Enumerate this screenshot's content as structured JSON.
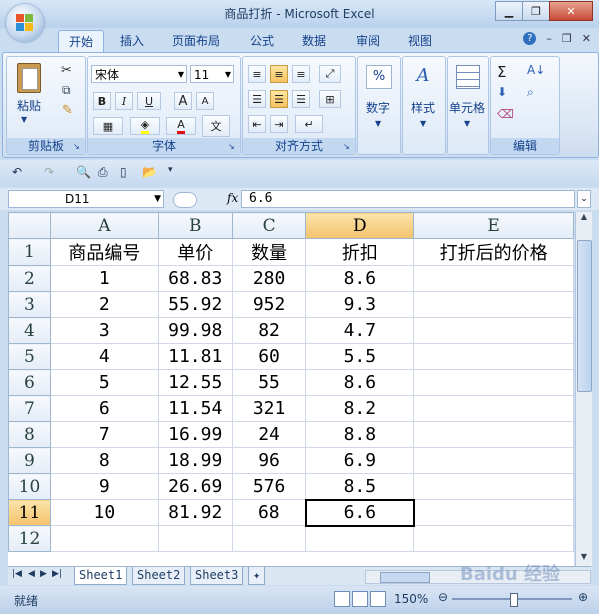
{
  "window": {
    "title": "商品打折 - Microsoft Excel"
  },
  "ribbon_tabs": [
    "开始",
    "插入",
    "页面布局",
    "公式",
    "数据",
    "审阅",
    "视图"
  ],
  "ribbon": {
    "clipboard": {
      "label": "剪贴板",
      "paste": "粘贴"
    },
    "font": {
      "label": "字体",
      "name": "宋体",
      "size": "11",
      "bold": "B",
      "italic": "I",
      "underline": "U",
      "grow": "A",
      "shrink": "A",
      "color": "A",
      "wen": "文"
    },
    "alignment": {
      "label": "对齐方式"
    },
    "number": {
      "label": "数字",
      "percent": "%"
    },
    "styles": {
      "label": "样式"
    },
    "cells": {
      "label": "单元格"
    },
    "editing": {
      "label": "编辑",
      "sum": "Σ"
    }
  },
  "formula_bar": {
    "name_box": "D11",
    "fx": "fx",
    "value": "6.6"
  },
  "sheet": {
    "columns": [
      "A",
      "B",
      "C",
      "D",
      "E"
    ],
    "rows": [
      {
        "num": "1",
        "cells": [
          "商品编号",
          "单价",
          "数量",
          "折扣",
          "打折后的价格"
        ]
      },
      {
        "num": "2",
        "cells": [
          "1",
          "68.83",
          "280",
          "8.6",
          ""
        ]
      },
      {
        "num": "3",
        "cells": [
          "2",
          "55.92",
          "952",
          "9.3",
          ""
        ]
      },
      {
        "num": "4",
        "cells": [
          "3",
          "99.98",
          "82",
          "4.7",
          ""
        ]
      },
      {
        "num": "5",
        "cells": [
          "4",
          "11.81",
          "60",
          "5.5",
          ""
        ]
      },
      {
        "num": "6",
        "cells": [
          "5",
          "12.55",
          "55",
          "8.6",
          ""
        ]
      },
      {
        "num": "7",
        "cells": [
          "6",
          "11.54",
          "321",
          "8.2",
          ""
        ]
      },
      {
        "num": "8",
        "cells": [
          "7",
          "16.99",
          "24",
          "8.8",
          ""
        ]
      },
      {
        "num": "9",
        "cells": [
          "8",
          "18.99",
          "96",
          "6.9",
          ""
        ]
      },
      {
        "num": "10",
        "cells": [
          "9",
          "26.69",
          "576",
          "8.5",
          ""
        ]
      },
      {
        "num": "11",
        "cells": [
          "10",
          "81.92",
          "68",
          "6.6",
          ""
        ]
      },
      {
        "num": "12",
        "cells": [
          "",
          "",
          "",
          "",
          ""
        ]
      }
    ],
    "active_cell": "D11",
    "tabs": [
      "Sheet1",
      "Sheet2",
      "Sheet3"
    ]
  },
  "status": {
    "ready": "就绪",
    "zoom": "150%"
  },
  "watermark": "Baidu 经验",
  "colors": {
    "selected_header": "#f3c26d",
    "ribbon_text": "#15428b"
  }
}
